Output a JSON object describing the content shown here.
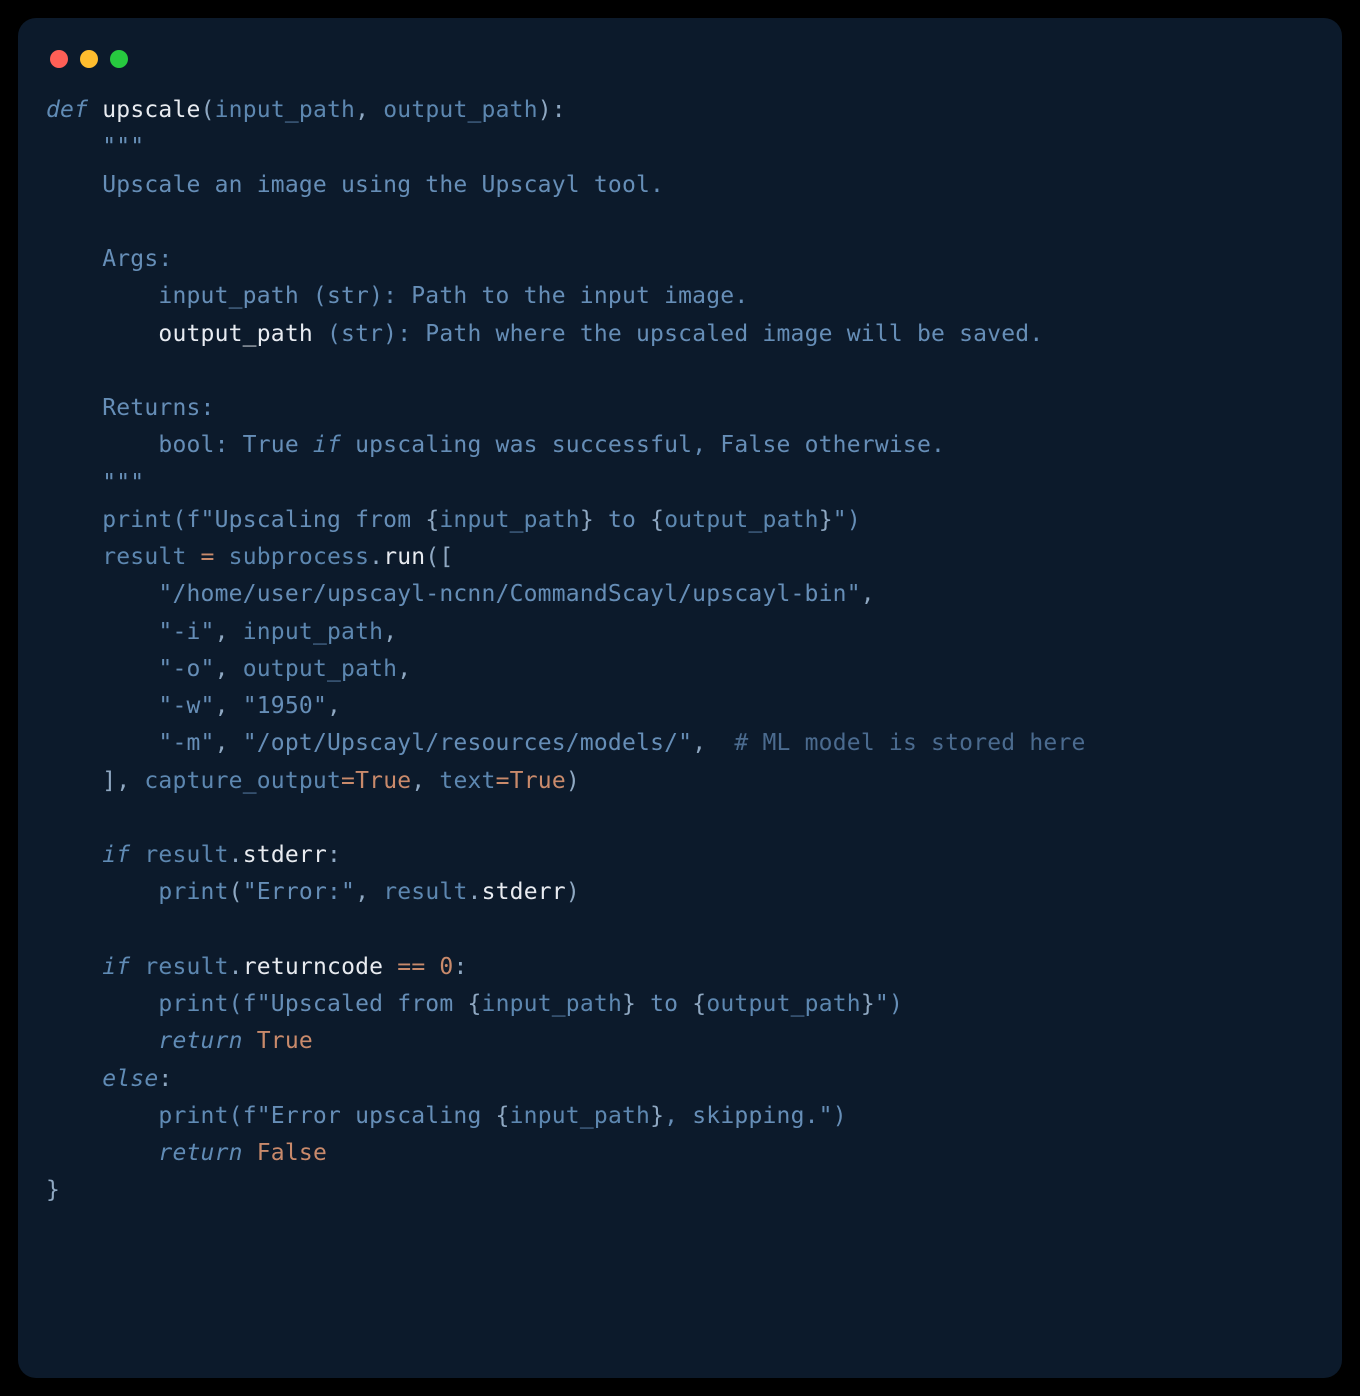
{
  "window": {
    "traffic_lights": [
      "close",
      "minimize",
      "zoom"
    ]
  },
  "code": {
    "def": "def",
    "fn_name": "upscale",
    "params_open": "(",
    "param1": "input_path",
    "comma": ", ",
    "param2": "output_path",
    "params_close": "):",
    "doc_q1": "\"\"\"",
    "doc_l1": "Upscale an image using the Upscayl tool.",
    "doc_args": "Args:",
    "doc_arg1a": "input_path (str): Path to the input image.",
    "doc_arg2a": "output_path",
    "doc_arg2b": " (str): Path where the upscaled image will be saved.",
    "doc_ret": "Returns:",
    "doc_ret1a": "bool: True ",
    "doc_ret1_if": "if",
    "doc_ret1b": " upscaling was successful, False otherwise.",
    "doc_q2": "\"\"\"",
    "print": "print",
    "fstr1a": "(f\"Upscaling from ",
    "fexpr_open": "{",
    "fexpr_ip": "input_path",
    "fexpr_close": "}",
    "fstr1b": " to ",
    "fexpr_op": "output_path",
    "fstr1c": "\")",
    "result": "result",
    "eq": " = ",
    "subprocess": "subprocess",
    "dot": ".",
    "run": "run",
    "run_open": "([",
    "s_bin": "\"/home/user/upscayl-ncnn/CommandScayl/upscayl-bin\"",
    "s_comma": ",",
    "s_i": "\"-i\"",
    "s_ip": "input_path",
    "s_o": "\"-o\"",
    "s_op": "output_path",
    "s_w": "\"-w\"",
    "s_wv": "\"1950\"",
    "s_m": "\"-m\"",
    "s_mp": "\"/opt/Upscayl/resources/models/\"",
    "s_mc": "# ML model is stored here",
    "run_close": "], ",
    "cap_out": "capture_output",
    "eq2": "=",
    "true": "True",
    "text_kw": "text",
    "close_paren": ")",
    "if": "if",
    "stderr": "stderr",
    "colon": ":",
    "err_lbl": "\"Error:\"",
    "returncode": "returncode",
    "eqeq": " == ",
    "zero": "0",
    "fstr2a": "(f\"Upscaled from ",
    "return": "return",
    "else": "else",
    "fstr3a": "(f\"Error upscaling ",
    "fstr3b": ", skipping.\")",
    "false": "False",
    "brace": "}"
  }
}
